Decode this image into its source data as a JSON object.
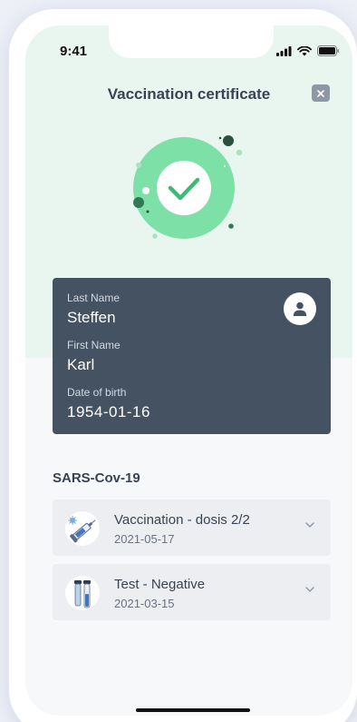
{
  "status_bar": {
    "time": "9:41"
  },
  "header": {
    "title": "Vaccination certificate"
  },
  "person": {
    "last_name_label": "Last Name",
    "last_name": "Steffen",
    "first_name_label": "First Name",
    "first_name": "Karl",
    "dob_label": "Date of birth",
    "dob": "1954-01-16"
  },
  "section": {
    "title": "SARS-Cov-19"
  },
  "records": [
    {
      "title": "Vaccination - dosis 2/2",
      "date": "2021-05-17",
      "icon": "syringe-icon"
    },
    {
      "title": "Test - Negative",
      "date": "2021-03-15",
      "icon": "test-tube-icon"
    }
  ],
  "colors": {
    "accent_green": "#5fd596",
    "check_green": "#3dba78",
    "card_bg": "#445262",
    "hero_bg": "#e9f6f0"
  }
}
